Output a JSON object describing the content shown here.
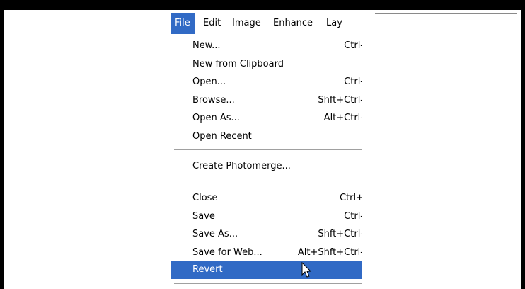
{
  "menubar": {
    "items": [
      {
        "label": "File",
        "active": true
      },
      {
        "label": "Edit",
        "active": false
      },
      {
        "label": "Image",
        "active": false
      },
      {
        "label": "Enhance",
        "active": false
      },
      {
        "label": "Lay",
        "active": false
      }
    ]
  },
  "file_menu": {
    "items": [
      {
        "label": "New...",
        "shortcut": "Ctrl-"
      },
      {
        "label": "New from Clipboard",
        "shortcut": ""
      },
      {
        "label": "Open...",
        "shortcut": "Ctrl-"
      },
      {
        "label": "Browse...",
        "shortcut": "Shft+Ctrl-"
      },
      {
        "label": "Open As...",
        "shortcut": "Alt+Ctrl-"
      },
      {
        "label": "Open Recent",
        "shortcut": ""
      },
      {
        "label": "Create Photomerge...",
        "shortcut": ""
      },
      {
        "label": "Close",
        "shortcut": "Ctrl+"
      },
      {
        "label": "Save",
        "shortcut": "Ctrl-"
      },
      {
        "label": "Save As...",
        "shortcut": "Shft+Ctrl-"
      },
      {
        "label": "Save for Web...",
        "shortcut": "Alt+Shft+Ctrl-"
      },
      {
        "label": "Revert",
        "shortcut": ""
      }
    ],
    "highlighted_item": "Revert"
  },
  "colors": {
    "highlight": "#316ac5",
    "frame": "#000000",
    "separator": "#a0a0a0"
  },
  "icons": {
    "cursor": "mouse-pointer-icon"
  }
}
